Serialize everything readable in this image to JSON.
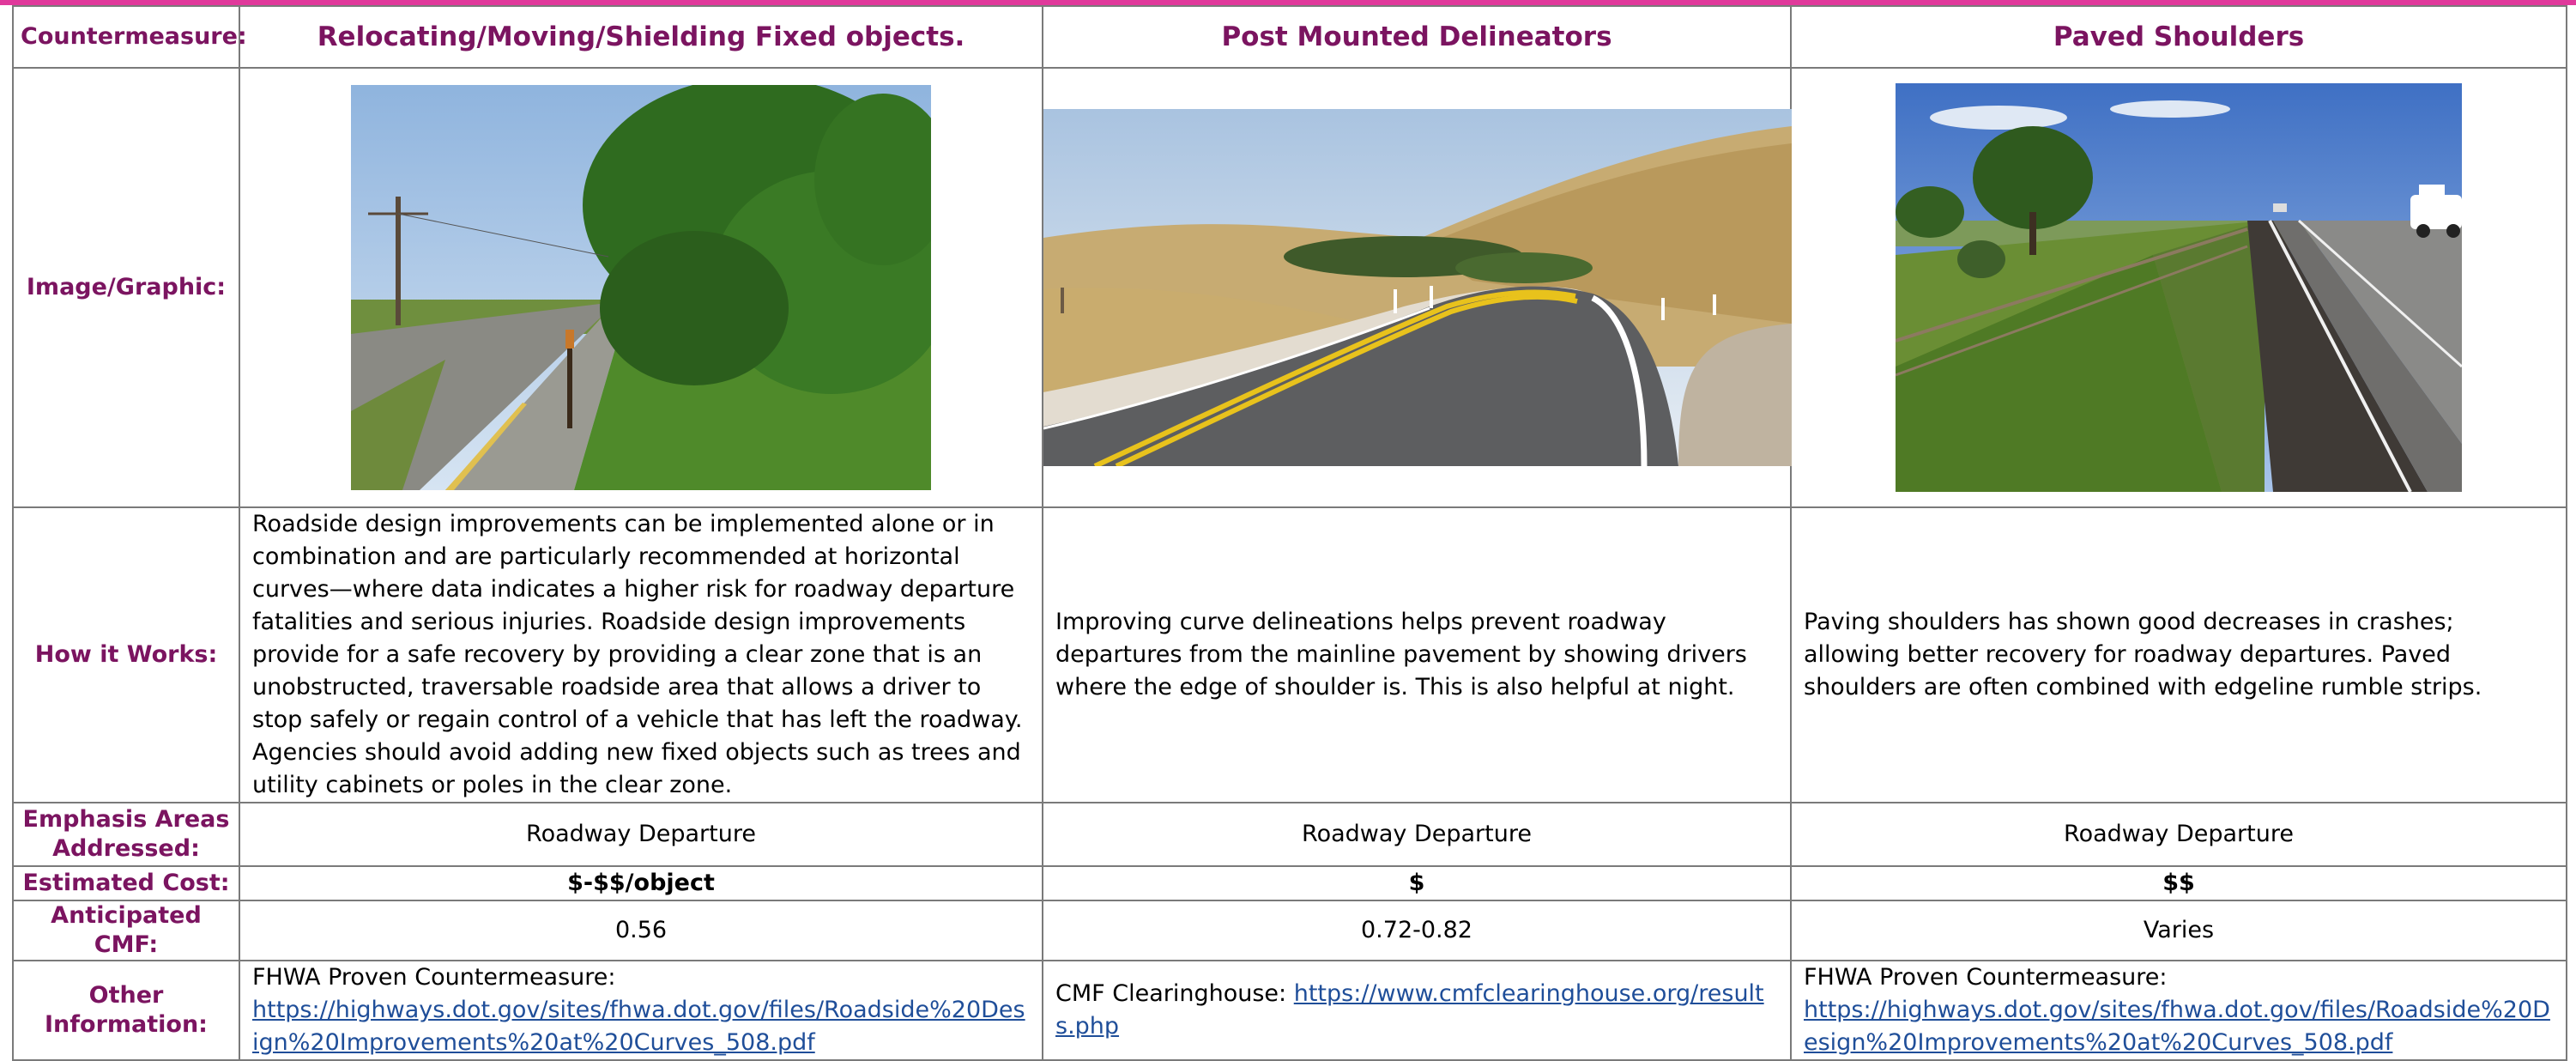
{
  "labels": {
    "countermeasure": "Countermeasure:",
    "image": "Image/Graphic:",
    "how": "How it Works:",
    "emphasis": "Emphasis Areas Addressed:",
    "cost": "Estimated Cost:",
    "cmf": "Anticipated CMF:",
    "other": "Other Information:"
  },
  "columns": [
    {
      "title": "Relocating/Moving/Shielding Fixed objects.",
      "how": "Roadside design improvements can be implemented alone or in combination and are particularly recommended at horizontal curves—where data indicates a higher risk for roadway departure fatalities and serious injuries. Roadside design improvements provide for a safe recovery by providing a clear zone that is an unobstructed, traversable roadside area that allows a driver to stop safely or regain control of a vehicle that has left the roadway. Agencies should avoid adding new fixed objects such as trees and utility cabinets or poles in the clear zone.",
      "emphasis": "Roadway Departure",
      "cost": "$-$$/object",
      "cmf": "0.56",
      "other_prefix": "FHWA Proven Countermeasure:",
      "other_link": "https://highways.dot.gov/sites/fhwa.dot.gov/files/Roadside%20Design%20Improvements%20at%20Curves_508.pdf"
    },
    {
      "title": "Post Mounted Delineators",
      "how": "Improving curve delineations helps prevent roadway departures from the mainline pavement by showing drivers where the edge of shoulder is. This is also helpful at night.",
      "emphasis": "Roadway Departure",
      "cost": "$",
      "cmf": "0.72-0.82",
      "other_prefix": "CMF Clearinghouse: ",
      "other_link": "https://www.cmfclearinghouse.org/results.php"
    },
    {
      "title": "Paved Shoulders",
      "how": "Paving shoulders has shown good decreases in crashes; allowing better recovery for roadway departures. Paved shoulders are often combined with edgeline rumble strips.",
      "emphasis": "Roadway Departure",
      "cost": "$$",
      "cmf": "Varies",
      "other_prefix": "FHWA Proven Countermeasure:",
      "other_link": "https://highways.dot.gov/sites/fhwa.dot.gov/files/Roadside%20Design%20Improvements%20at%20Curves_508.pdf"
    }
  ]
}
